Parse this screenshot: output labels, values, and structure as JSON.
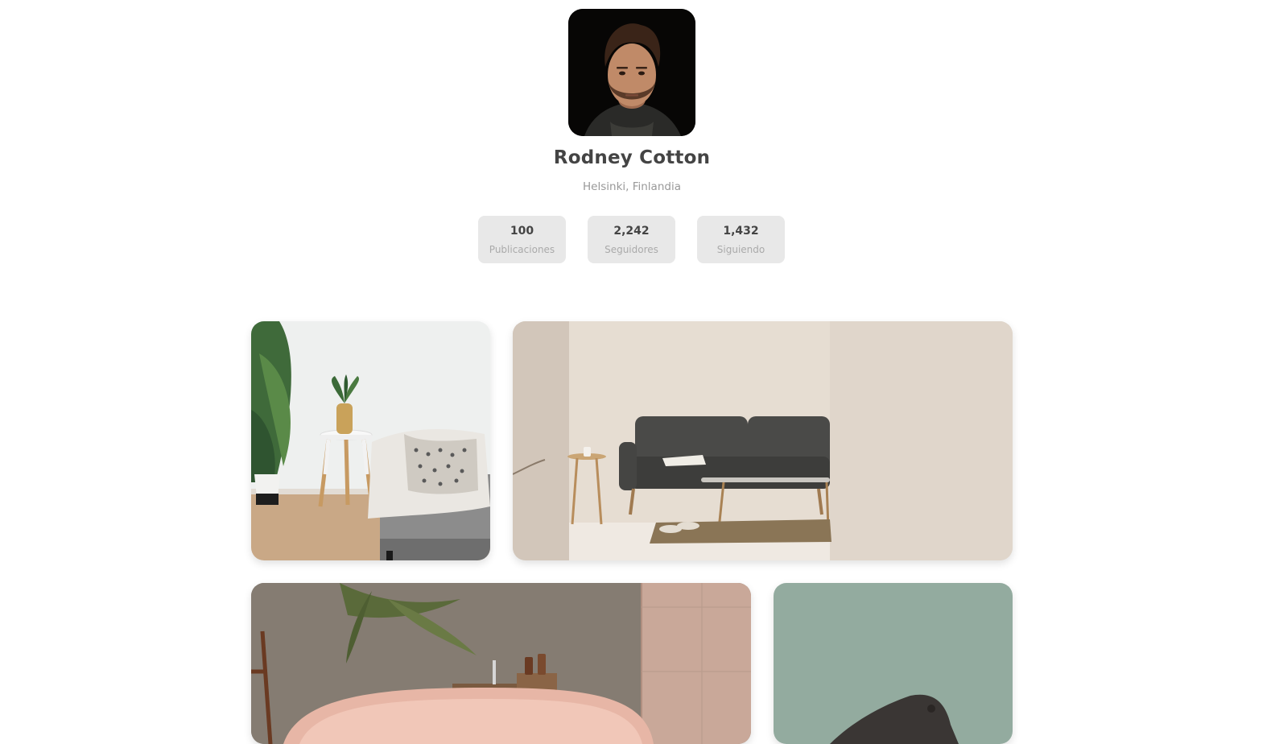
{
  "profile": {
    "avatar_alt": "Profile photo",
    "name": "Rodney Cotton",
    "location": "Helsinki, Finlandia"
  },
  "stats": [
    {
      "value": "100",
      "label": "Publicaciones"
    },
    {
      "value": "2,242",
      "label": "Seguidores"
    },
    {
      "value": "1,432",
      "label": "Siguiendo"
    }
  ],
  "gallery": {
    "posts": [
      {
        "subject": "living-room-side-table"
      },
      {
        "subject": "grey-sofa-living-room"
      },
      {
        "subject": "pink-bathtub"
      },
      {
        "subject": "green-wall-chair"
      }
    ]
  }
}
